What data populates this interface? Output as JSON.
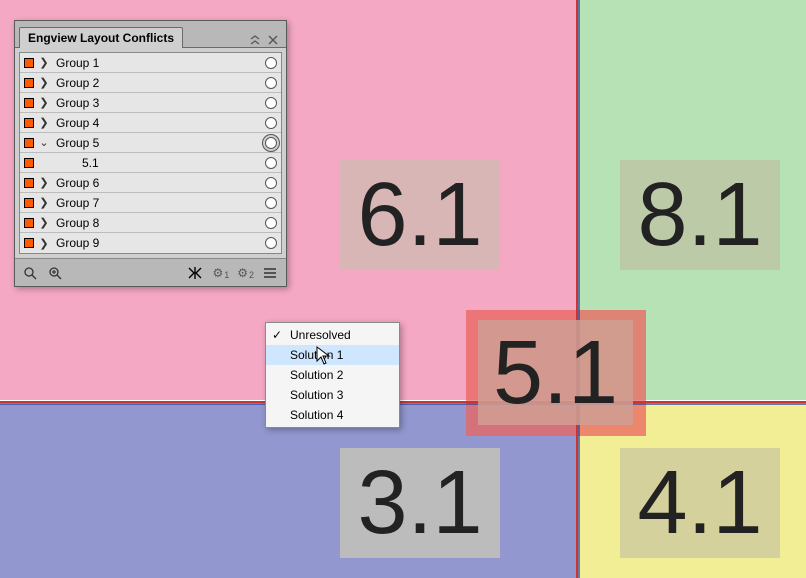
{
  "panel": {
    "title": "Engview Layout Conflicts",
    "groups": [
      {
        "label": "Group 1",
        "expanded": false,
        "selected": false
      },
      {
        "label": "Group 2",
        "expanded": false,
        "selected": false
      },
      {
        "label": "Group 3",
        "expanded": false,
        "selected": false
      },
      {
        "label": "Group 4",
        "expanded": false,
        "selected": false
      },
      {
        "label": "Group 5",
        "expanded": true,
        "selected": true,
        "child": "5.1"
      },
      {
        "label": "Group 6",
        "expanded": false,
        "selected": false
      },
      {
        "label": "Group 7",
        "expanded": false,
        "selected": false
      },
      {
        "label": "Group 8",
        "expanded": false,
        "selected": false
      },
      {
        "label": "Group 9",
        "expanded": false,
        "selected": false
      }
    ],
    "footer": {
      "gear1": "1",
      "gear2": "2"
    }
  },
  "context_menu": {
    "items": [
      {
        "label": "Unresolved",
        "checked": true,
        "hover": false
      },
      {
        "label": "Solution 1",
        "checked": false,
        "hover": true
      },
      {
        "label": "Solution 2",
        "checked": false,
        "hover": false
      },
      {
        "label": "Solution 3",
        "checked": false,
        "hover": false
      },
      {
        "label": "Solution 4",
        "checked": false,
        "hover": false
      }
    ]
  },
  "canvas": {
    "regions": {
      "pink": {
        "label": "6.1",
        "bg": "#f4a8c3",
        "box_bg": "#d8b6b6"
      },
      "green": {
        "label": "8.1",
        "bg": "#b6e2b6",
        "box_bg": "#bccaa8"
      },
      "red": {
        "label": "5.1",
        "bg": "#e98a86",
        "box_bg": "#cf9f93"
      },
      "purple": {
        "label": "3.1",
        "bg": "#9298cf",
        "box_bg": "#bcbcbc"
      },
      "yellow": {
        "label": "4.1",
        "bg": "#f1ee96",
        "box_bg": "#d4d19c"
      }
    },
    "guides": {
      "h_colors": [
        "#cc3333",
        "#2b4aa0"
      ],
      "v_colors": [
        "#cc3333",
        "#2b4aa0"
      ]
    }
  }
}
